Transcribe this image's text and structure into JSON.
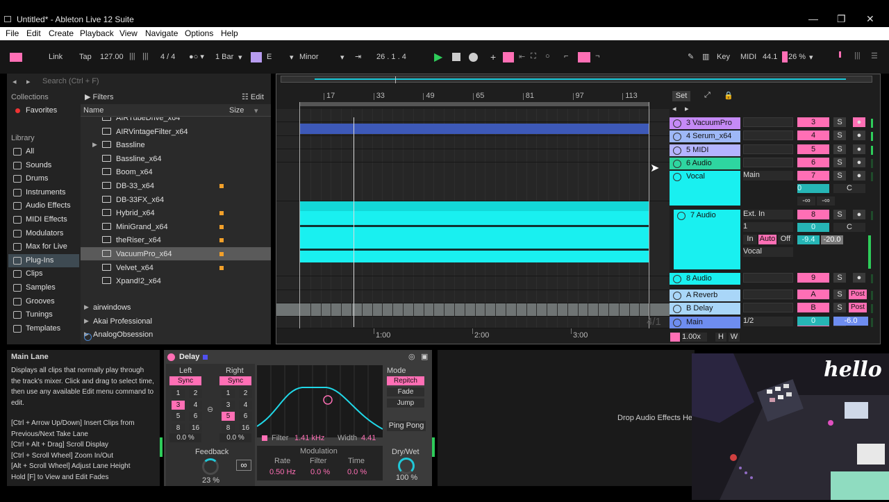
{
  "window": {
    "title": "Untitled* - Ableton Live 12 Suite"
  },
  "menu": [
    "File",
    "Edit",
    "Create",
    "Playback",
    "View",
    "Navigate",
    "Options",
    "Help"
  ],
  "control_bar": {
    "link": "Link",
    "tap": "Tap",
    "tempo": "127.00",
    "signature": "4 / 4",
    "quantize": "1 Bar",
    "key": "E",
    "scale": "Minor",
    "position": "26 .  1 .  4",
    "key_label": "Key",
    "midi_label": "MIDI",
    "sample_rate": "44.1",
    "cpu": "26 %"
  },
  "browser": {
    "search_placeholder": "Search (Ctrl + F)",
    "collections_header": "Collections",
    "favorites": "Favorites",
    "library_header": "Library",
    "library": [
      "All",
      "Sounds",
      "Drums",
      "Instruments",
      "Audio Effects",
      "MIDI Effects",
      "Modulators",
      "Max for Live",
      "Plug-Ins",
      "Clips",
      "Samples",
      "Grooves",
      "Tunings",
      "Templates"
    ],
    "filters": "Filters",
    "edit": "Edit",
    "col_name": "Name",
    "col_size": "Size",
    "items": [
      {
        "name": "AIRTubeDrive_x64",
        "dot": false
      },
      {
        "name": "AIRVintageFilter_x64",
        "dot": false
      },
      {
        "name": "Bassline",
        "dot": false
      },
      {
        "name": "Bassline_x64",
        "dot": false
      },
      {
        "name": "Boom_x64",
        "dot": false
      },
      {
        "name": "DB-33_x64",
        "dot": true
      },
      {
        "name": "DB-33FX_x64",
        "dot": false
      },
      {
        "name": "Hybrid_x64",
        "dot": true
      },
      {
        "name": "MiniGrand_x64",
        "dot": true
      },
      {
        "name": "theRiser_x64",
        "dot": true
      },
      {
        "name": "VacuumPro_x64",
        "dot": true
      },
      {
        "name": "Velvet_x64",
        "dot": true
      },
      {
        "name": "Xpand!2_x64",
        "dot": false
      }
    ],
    "folders": [
      "airwindows",
      "Akai Professional",
      "AnalogObsession"
    ]
  },
  "arrangement": {
    "bar_ruler": [
      "17",
      "33",
      "49",
      "65",
      "81",
      "97",
      "113"
    ],
    "time_ruler": [
      "1:00",
      "2:00",
      "3:00"
    ],
    "set_label": "Set",
    "grid_label": "4/1",
    "zoom": "1.00x",
    "h": "H",
    "w": "W"
  },
  "tracks": [
    {
      "name": "3 VacuumPro",
      "color": "#c58af6",
      "num": "3"
    },
    {
      "name": "4 Serum_x64",
      "color": "#9eb8f7",
      "num": "4"
    },
    {
      "name": "5 MIDI",
      "color": "#b4b4ff",
      "num": "5"
    },
    {
      "name": "6 Audio",
      "color": "#2ed6a0",
      "num": "6"
    },
    {
      "name": "Vocal",
      "color": "#19f0f0",
      "num": "7"
    },
    {
      "name": "7 Audio",
      "color": "#19f0f0",
      "num": "8"
    },
    {
      "name": "8 Audio",
      "color": "#19f0f0",
      "num": "9"
    },
    {
      "name": "A Reverb",
      "color": "#a9d6f8",
      "num": "A"
    },
    {
      "name": "B Delay",
      "color": "#a9d6f8",
      "num": "B"
    },
    {
      "name": "Main",
      "color": "#6e8df0",
      "num": "0"
    }
  ],
  "mixer": {
    "s": "S",
    "c": "C",
    "vocal_out": "Main",
    "minus_inf": "-∞",
    "in_from": "Ext. In",
    "in_channel": "1",
    "in": "In",
    "auto": "Auto",
    "off": "Off",
    "vol_a": "-9.4",
    "vol_b": "-20.0",
    "out_vocal": "Vocal",
    "post": "Post",
    "main_out": "1/2",
    "main_vol": "-6.0",
    "zero": "0"
  },
  "info": {
    "title": "Main Lane",
    "body": "Displays all clips that normally play through the track's mixer. Click and drag to select time, then use any available Edit menu command to edit.",
    "lines": [
      "[Ctrl + Arrow Up/Down] Insert Clips from Previous/Next Take Lane",
      "[Ctrl + Alt + Drag] Scroll Display",
      "[Ctrl + Scroll Wheel] Zoom In/Out",
      "[Alt + Scroll Wheel] Adjust Lane Height",
      "Hold [F] to View and Edit Fades"
    ]
  },
  "delay": {
    "title": "Delay",
    "left": "Left",
    "right": "Right",
    "sync": "Sync",
    "left_grid": [
      "1",
      "2",
      "3",
      "4",
      "5",
      "6",
      "8",
      "16"
    ],
    "left_sel": "3",
    "left_offset": "0.0 %",
    "right_grid": [
      "1",
      "2",
      "3",
      "4",
      "5",
      "6",
      "8",
      "16"
    ],
    "right_sel": "5",
    "right_offset": "0.0 %",
    "feedback_label": "Feedback",
    "feedback": "23 %",
    "filter_label": "Filter",
    "filter": "1.41 kHz",
    "width_label": "Width",
    "width": "4.41",
    "modulation": "Modulation",
    "rate_label": "Rate",
    "rate": "0.50 Hz",
    "mfilter_label": "Filter",
    "mfilter": "0.0 %",
    "time_label": "Time",
    "time": "0.0 %",
    "mode": "Mode",
    "modes": [
      "Repitch",
      "Fade",
      "Jump"
    ],
    "ping_pong": "Ping Pong",
    "drywet_label": "Dry/Wet",
    "drywet": "100 %"
  },
  "drop_hint": "Drop Audio Effects He",
  "overlay_text": "hello"
}
